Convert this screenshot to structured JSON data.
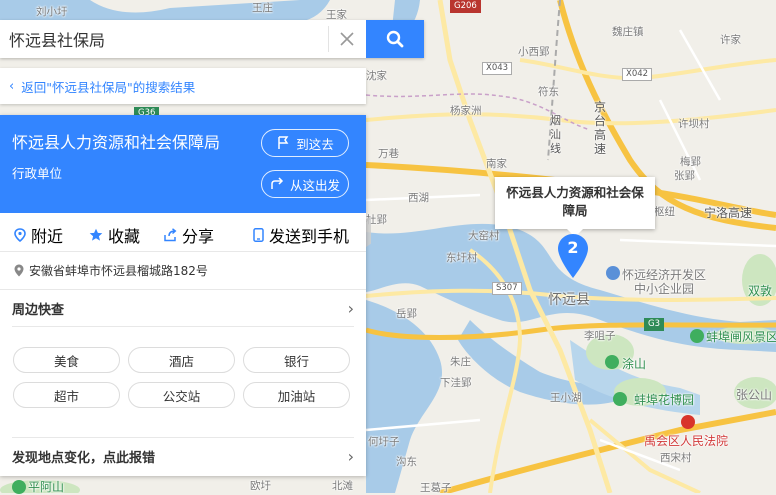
{
  "search": {
    "query": "怀远县社保局"
  },
  "back_link": "返回\"怀远县社保局\"的搜索结果",
  "place": {
    "name": "怀远县人力资源和社会保障局",
    "type": "行政单位",
    "route_to": "到这去",
    "route_from": "从这出发",
    "address": "安徽省蚌埠市怀远县榴城路182号"
  },
  "actions": [
    "附近",
    "收藏",
    "分享",
    "发送到手机"
  ],
  "nearby": {
    "title": "周边快查",
    "chips": [
      "美食",
      "酒店",
      "银行",
      "超市",
      "公交站",
      "加油站"
    ]
  },
  "report": "发现地点变化，点此报错",
  "marker": {
    "number": "2",
    "callout": "怀远县人力资源和社会保障局"
  },
  "map_labels": {
    "county": "怀远县",
    "places": [
      "刘小圩",
      "王庄",
      "王家",
      "魏庄镇",
      "小西郢",
      "许家",
      "沈家",
      "符东",
      "杨家洲",
      "许坝村",
      "南家",
      "万巷",
      "梅郢",
      "张郢",
      "西湖",
      "枢纽",
      "杜郢",
      "大窑村",
      "东圩村",
      "岳郢",
      "朱庄",
      "下洼郢",
      "李咀子",
      "王小湖",
      "何圩子",
      "沟东",
      "王葛子",
      "北滩",
      "欧圩",
      "平阿山",
      "涂山",
      "西宋村",
      "张公山",
      "双敦",
      "怀远经济开发区",
      "中小企业园",
      "蚌埠闸风景区",
      "蚌埠花博园",
      "禹会区人民法院"
    ],
    "roads": [
      "京台高速",
      "宁洛高速",
      "烟汕线"
    ],
    "shields": [
      "G206",
      "X043",
      "X042",
      "G36",
      "S307",
      "G3"
    ]
  },
  "colors": {
    "accent": "#3385ff",
    "water": "#a8cbe8",
    "expressway": "#f7c342",
    "arterial": "#fde9a4",
    "land": "#f1efe9",
    "green": "#cde6c0"
  }
}
